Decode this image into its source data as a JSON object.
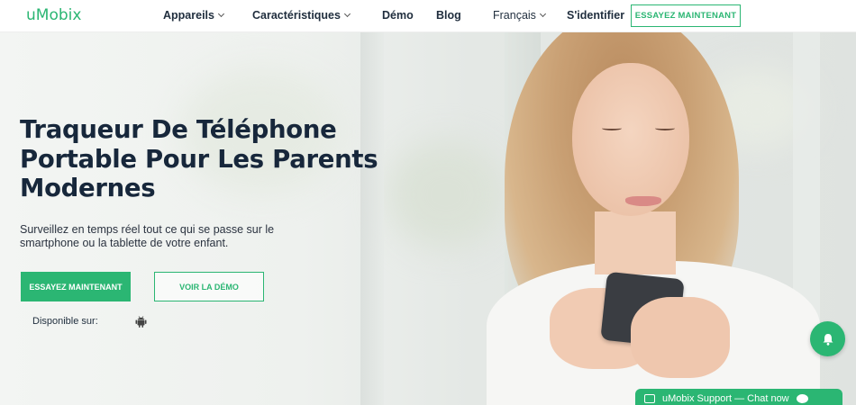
{
  "header": {
    "logo": "uMobix",
    "nav": [
      {
        "label": "Appareils",
        "dropdown": true
      },
      {
        "label": "Caractéristiques",
        "dropdown": true
      },
      {
        "label": "Démo",
        "dropdown": false
      },
      {
        "label": "Blog",
        "dropdown": false
      }
    ],
    "language": "Français",
    "signin": "S'identifier",
    "cta": "ESSAYEZ MAINTENANT"
  },
  "hero": {
    "title_lines": [
      "Traqueur De Téléphone",
      "Portable Pour Les Parents",
      "Modernes"
    ],
    "subtitle_lines": [
      "Surveillez en temps réel tout ce qui se passe sur le",
      "smartphone ou la tablette de votre enfant."
    ],
    "primary_button": "ESSAYEZ MAINTENANT",
    "secondary_button": "VOIR LA DÉMO",
    "available_label": "Disponible sur:",
    "available_icon": "android-icon"
  },
  "chat": {
    "label": "uMobix Support — Chat now"
  },
  "colors": {
    "accent": "#2bb673",
    "heading": "#17273b"
  }
}
